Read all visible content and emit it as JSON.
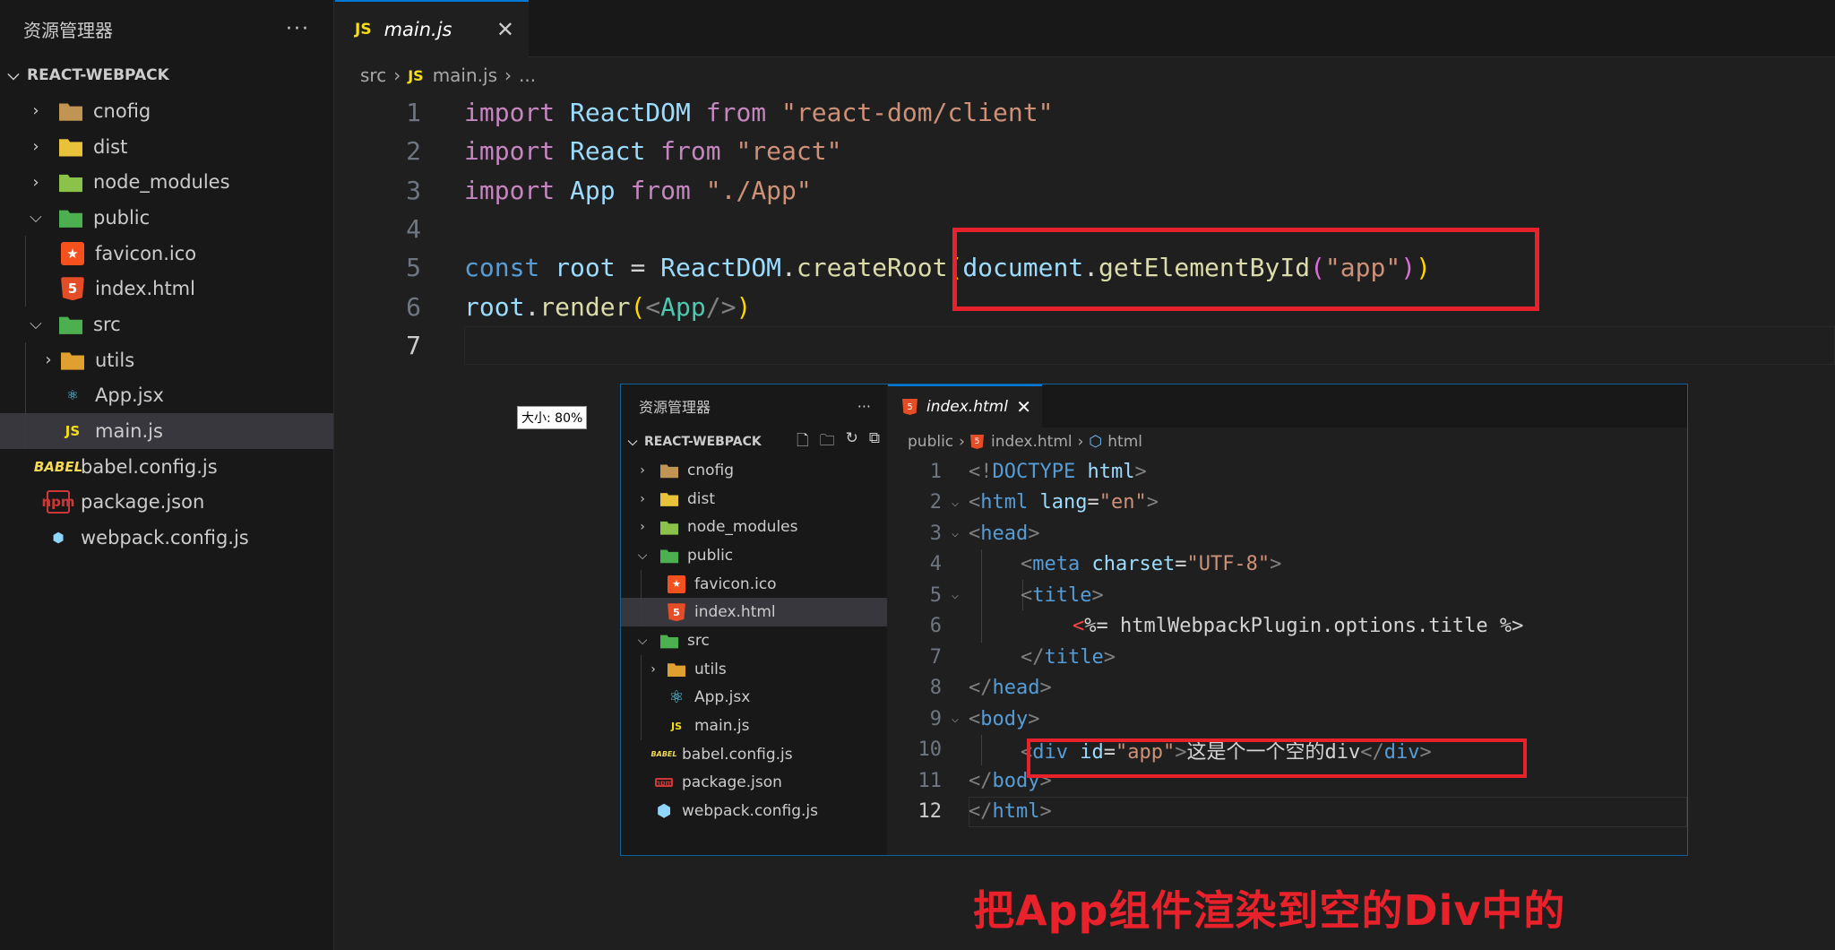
{
  "sidebar": {
    "title": "资源管理器",
    "more": "···",
    "root": "REACT-WEBPACK",
    "items": [
      {
        "label": "cnofig"
      },
      {
        "label": "dist"
      },
      {
        "label": "node_modules"
      },
      {
        "label": "public"
      },
      {
        "label": "favicon.ico"
      },
      {
        "label": "index.html"
      },
      {
        "label": "src"
      },
      {
        "label": "utils"
      },
      {
        "label": "App.jsx"
      },
      {
        "label": "main.js"
      },
      {
        "label": "babel.config.js"
      },
      {
        "label": "package.json"
      },
      {
        "label": "webpack.config.js"
      }
    ]
  },
  "editor": {
    "tab": {
      "badge": "JS",
      "label": "main.js",
      "close": "✕"
    },
    "breadcrumb": {
      "folder": "src",
      "badge": "JS",
      "file": "main.js",
      "more": "..."
    },
    "line_numbers": [
      "1",
      "2",
      "3",
      "4",
      "5",
      "6",
      "7"
    ],
    "lines": {
      "l1": {
        "kw": "import",
        "id": "ReactDOM",
        "from": "from",
        "str": "\"react-dom/client\""
      },
      "l2": {
        "kw": "import",
        "id": "React",
        "from": "from",
        "str": "\"react\""
      },
      "l3": {
        "kw": "import",
        "id": "App",
        "from": "from",
        "str": "\"./App\""
      },
      "l5": {
        "kw": "const",
        "var": "root",
        "eq": " = ",
        "obj": "ReactDOM",
        "dot": ".",
        "fn": "createRoot",
        "p1": "(",
        "doc": "document",
        "dot2": ".",
        "fn2": "getElementById",
        "p2": "(",
        "str": "\"app\"",
        "p3": ")",
        "p4": ")"
      },
      "l6": {
        "var": "root",
        "dot": ".",
        "fn": "render",
        "p1": "(",
        "lt": "<",
        "cls": "App",
        "end": "/>",
        "p2": ")"
      }
    }
  },
  "inner": {
    "zoom": "大小: 80%",
    "sidebar": {
      "title": "资源管理器",
      "more": "···",
      "root": "REACT-WEBPACK",
      "items": [
        {
          "label": "cnofig"
        },
        {
          "label": "dist"
        },
        {
          "label": "node_modules"
        },
        {
          "label": "public"
        },
        {
          "label": "favicon.ico"
        },
        {
          "label": "index.html"
        },
        {
          "label": "src"
        },
        {
          "label": "utils"
        },
        {
          "label": "App.jsx"
        },
        {
          "label": "main.js"
        },
        {
          "label": "babel.config.js"
        },
        {
          "label": "package.json"
        },
        {
          "label": "webpack.config.js"
        }
      ]
    },
    "tab": {
      "label": "index.html",
      "close": "✕"
    },
    "breadcrumb": {
      "folder": "public",
      "file": "index.html",
      "node": "html"
    },
    "line_numbers": [
      "1",
      "2",
      "3",
      "4",
      "5",
      "6",
      "7",
      "8",
      "9",
      "10",
      "11",
      "12"
    ],
    "lines": {
      "l1": {
        "a": "<!",
        "b": "DOCTYPE",
        "c": " html",
        "d": ">"
      },
      "l2": {
        "a": "<",
        "b": "html",
        "c": " lang",
        "d": "=",
        "e": "\"en\"",
        "f": ">"
      },
      "l3": {
        "a": "<",
        "b": "head",
        "c": ">"
      },
      "l4": {
        "a": "<",
        "b": "meta",
        "c": " charset",
        "d": "=",
        "e": "\"UTF-8\"",
        "f": ">"
      },
      "l5": {
        "a": "<",
        "b": "title",
        "c": ">"
      },
      "l6": {
        "a": "<",
        "b": "%= htmlWebpackPlugin.options.title %>"
      },
      "l7": {
        "a": "</",
        "b": "title",
        "c": ">"
      },
      "l8": {
        "a": "</",
        "b": "head",
        "c": ">"
      },
      "l9": {
        "a": "<",
        "b": "body",
        "c": ">"
      },
      "l10": {
        "a": "<",
        "b": "div",
        "c": " id",
        "d": "=",
        "e": "\"app\"",
        "f": ">",
        "g": "这是个一个空的div",
        "h": "</",
        "i": "div",
        "j": ">"
      },
      "l11": {
        "a": "</",
        "b": "body",
        "c": ">"
      },
      "l12": {
        "a": "</",
        "b": "html",
        "c": ">"
      }
    }
  },
  "caption": "把App组件渲染到空的Div中的",
  "colors": {
    "highlight": "#e8212a",
    "accent": "#0078d4"
  }
}
